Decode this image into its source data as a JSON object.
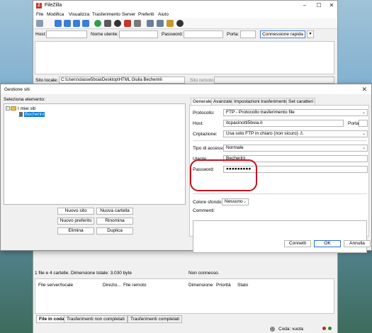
{
  "main_window": {
    "title": "FileZilla",
    "menu": [
      "File",
      "Modifica",
      "Visualizza",
      "Trasferimento",
      "Server",
      "Preferiti",
      "Aiuto"
    ],
    "quickconnect": {
      "host_label": "Host:",
      "username_label": "Nome utente:",
      "password_label": "Password:",
      "port_label": "Porta:",
      "connect_button": "Connessione rapida"
    },
    "local_site_label": "Sito locale:",
    "local_site_path": "C:\\Users\\classe5bsia\\Desktop\\HTML Giulia Becherini\\",
    "remote_site_label": "Sito remoto:",
    "local_status": "1 file e 4 cartelle. Dimensione totale: 3.030 byte",
    "remote_status": "Non connesso.",
    "queue_columns": [
      "File server/locale",
      "Direzio...",
      "File remoto",
      "Dimensione",
      "Priorità",
      "Stato"
    ],
    "queue_tabs": [
      "File in coda",
      "Trasferimenti non completati",
      "Trasferimenti completati"
    ],
    "queue_status": "Coda: vuota"
  },
  "site_manager": {
    "title": "Gestione siti",
    "select_entry_label": "Seleziona elemento:",
    "tree": {
      "root": "I miei siti",
      "child": "Becherini"
    },
    "buttons": {
      "new_site": "Nuovo sito",
      "new_folder": "Nuova cartella",
      "new_bookmark": "Nuovo preferito",
      "rename": "Rinomina",
      "delete": "Elimina",
      "duplicate": "Duplica"
    },
    "tabs": [
      "Generale",
      "Avanzate",
      "Impostazioni trasferimento",
      "Set caratteri"
    ],
    "general": {
      "protocol_label": "Protocollo:",
      "protocol_value": "FTP - Protocollo trasferimento file",
      "host_label": "Host:",
      "host_value": "itcpacinotti5bsia.it",
      "port_label": "Porta:",
      "port_value": "",
      "encryption_label": "Criptazione:",
      "encryption_value": "Usa solo FTP in chiaro (non sicuro) ⚠",
      "logon_type_label": "Tipo di accesso:",
      "logon_type_value": "Normale",
      "user_label": "Utente:",
      "user_value": "Becherini",
      "password_label": "Password:",
      "password_value": "●●●●●●●●●",
      "background_color_label": "Colore sfondo:",
      "background_color_value": "Nessuno",
      "comments_label": "Commenti:"
    },
    "footer": {
      "connect": "Connetti",
      "ok": "OK",
      "cancel": "Annulla"
    }
  },
  "colors": {
    "highlight_circle": "#c0151d",
    "selection": "#0078d7",
    "window_bg": "#f0f0f0"
  }
}
